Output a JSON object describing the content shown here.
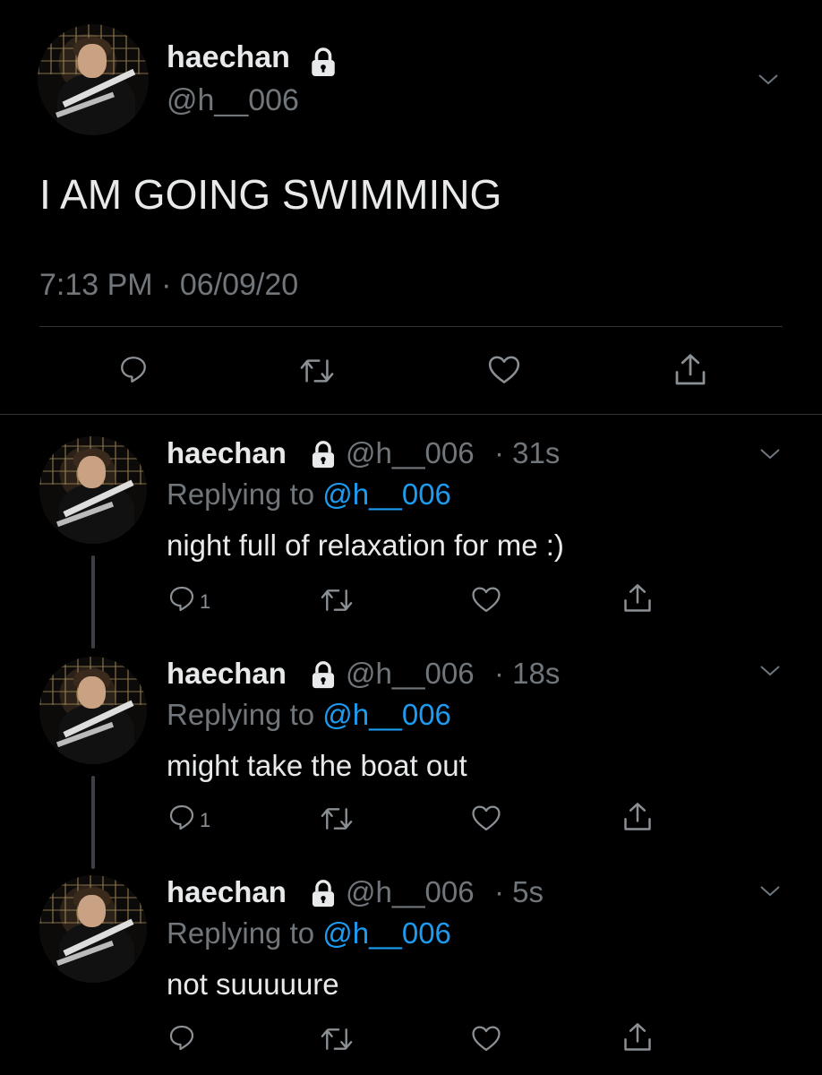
{
  "main_tweet": {
    "name": "haechan",
    "handle": "@h__006",
    "text": "I AM GOING SWIMMING",
    "timestamp": "7:13 PM · 06/09/20"
  },
  "replies": [
    {
      "name": "haechan",
      "handle": "@h__006",
      "time": "· 31s",
      "replying_label": "Replying to",
      "replying_handle": "@h__006",
      "text": "night full of relaxation for me :)",
      "reply_count": "1"
    },
    {
      "name": "haechan",
      "handle": "@h__006",
      "time": "· 18s",
      "replying_label": "Replying to",
      "replying_handle": "@h__006",
      "text": "might take the boat out",
      "reply_count": "1"
    },
    {
      "name": "haechan",
      "handle": "@h__006",
      "time": "· 5s",
      "replying_label": "Replying to",
      "replying_handle": "@h__006",
      "text": "not suuuuure",
      "reply_count": ""
    }
  ],
  "icons": {
    "protected": "lock-icon",
    "reply": "comment-icon",
    "retweet": "retweet-icon",
    "like": "heart-icon",
    "share": "share-icon",
    "more": "chevron-down-icon"
  },
  "colors": {
    "background": "#000000",
    "text": "#e7e9ea",
    "secondary": "#71767b",
    "accent": "#1d9bf0"
  }
}
